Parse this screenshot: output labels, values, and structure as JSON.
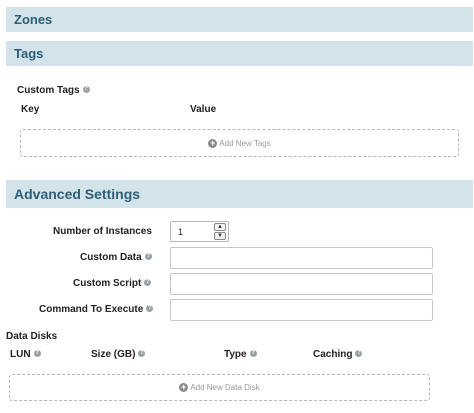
{
  "sections": {
    "zones": "Zones",
    "tags": "Tags",
    "advanced": "Advanced Settings"
  },
  "tags": {
    "custom_tags_label": "Custom Tags",
    "columns": [
      "Key",
      "Value"
    ],
    "add_button": "Add New Tags"
  },
  "advanced": {
    "number_of_instances_label": "Number of Instances",
    "number_of_instances_value": "1",
    "custom_data_label": "Custom Data",
    "custom_script_label": "Custom Script",
    "command_label": "Command To Execute"
  },
  "data_disks": {
    "title": "Data Disks",
    "columns": [
      "LUN",
      "Size (GB)",
      "Type",
      "Caching"
    ],
    "add_button": "Add New Data Disk"
  }
}
